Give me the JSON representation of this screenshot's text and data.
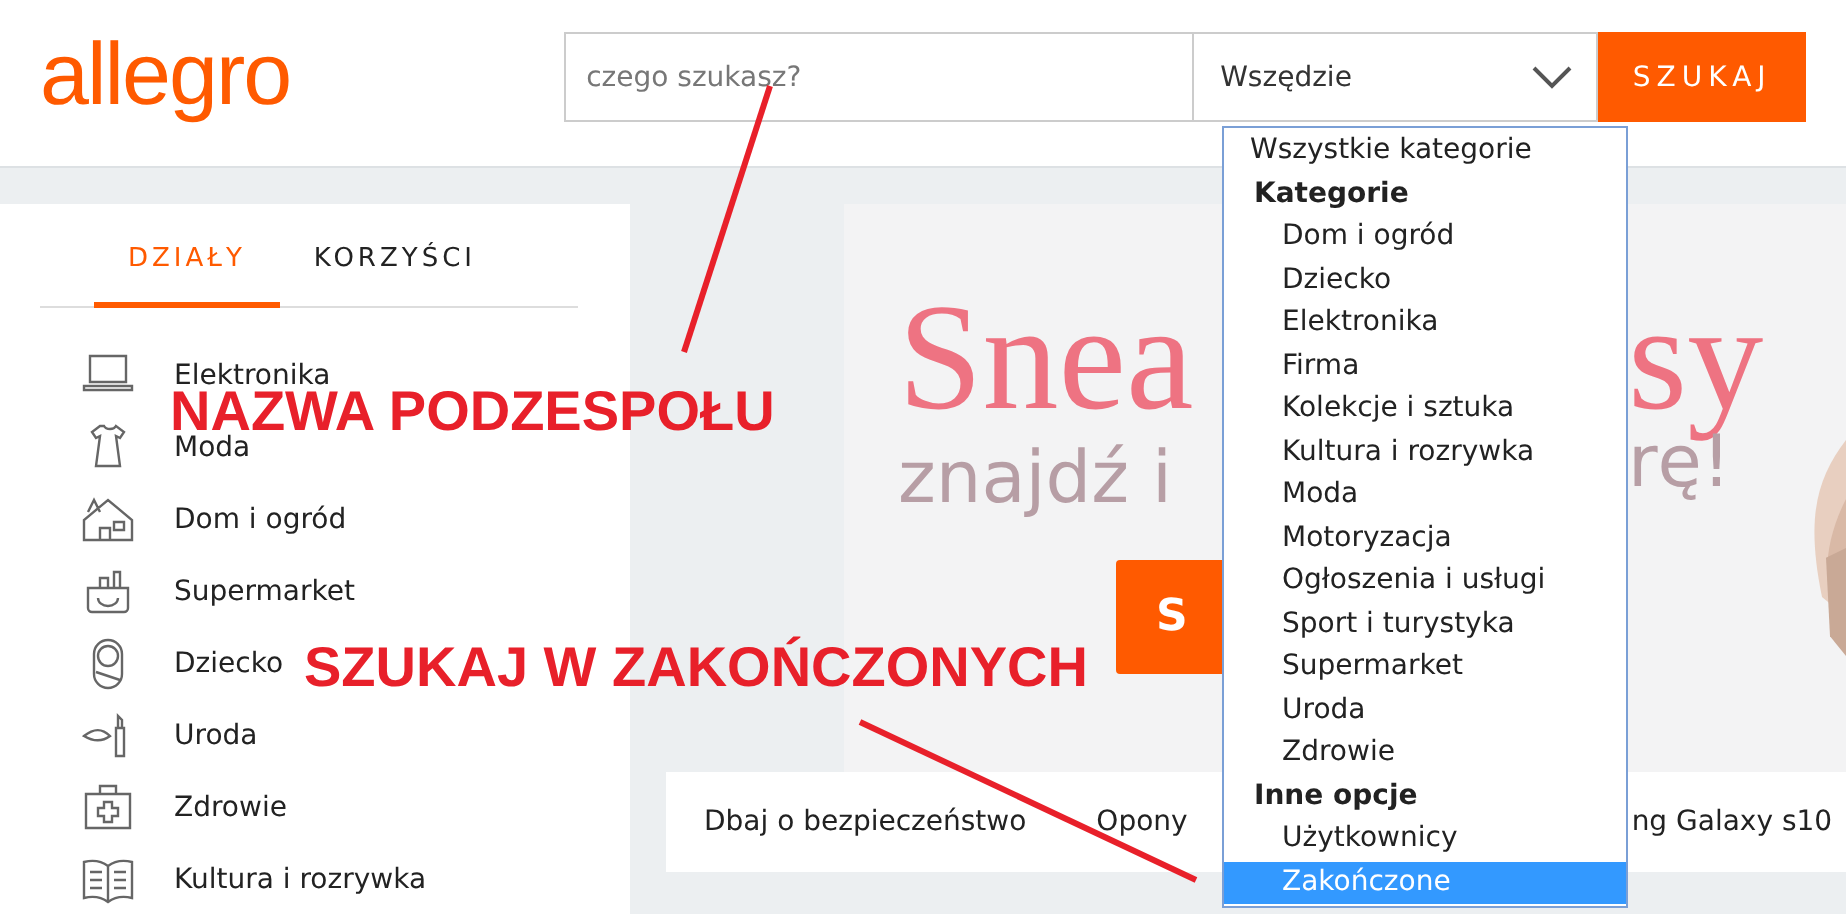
{
  "header": {
    "logo": "allegro",
    "search": {
      "placeholder": "czego szukasz?"
    },
    "scope_select": {
      "value": "Wszędzie"
    },
    "search_button": "SZUKAJ"
  },
  "sidebar": {
    "tabs": [
      {
        "label": "DZIAŁY",
        "selected": true
      },
      {
        "label": "KORZYŚCI",
        "selected": false
      }
    ],
    "items": [
      {
        "label": "Elektronika"
      },
      {
        "label": "Moda"
      },
      {
        "label": "Dom i ogród"
      },
      {
        "label": "Supermarket"
      },
      {
        "label": "Dziecko"
      },
      {
        "label": "Uroda"
      },
      {
        "label": "Zdrowie"
      },
      {
        "label": "Kultura i rozrywka"
      }
    ]
  },
  "banner": {
    "headline": [
      "Snea",
      "sy"
    ],
    "subline": [
      "znajdź i",
      "rę!"
    ],
    "button": "S"
  },
  "quick_links": [
    "Dbaj o bezpieczeństwo",
    "Opony",
    "ng Galaxy s10"
  ],
  "scope_dropdown": {
    "items": [
      {
        "kind": "option",
        "label": "Wszystkie kategorie",
        "selected": false
      },
      {
        "kind": "group",
        "label": "Kategorie"
      },
      {
        "kind": "sub",
        "label": "Dom i ogród",
        "selected": false
      },
      {
        "kind": "sub",
        "label": "Dziecko",
        "selected": false
      },
      {
        "kind": "sub",
        "label": "Elektronika",
        "selected": false
      },
      {
        "kind": "sub",
        "label": "Firma",
        "selected": false
      },
      {
        "kind": "sub",
        "label": "Kolekcje i sztuka",
        "selected": false
      },
      {
        "kind": "sub",
        "label": "Kultura i rozrywka",
        "selected": false
      },
      {
        "kind": "sub",
        "label": "Moda",
        "selected": false
      },
      {
        "kind": "sub",
        "label": "Motoryzacja",
        "selected": false
      },
      {
        "kind": "sub",
        "label": "Ogłoszenia i usługi",
        "selected": false
      },
      {
        "kind": "sub",
        "label": "Sport i turystyka",
        "selected": false
      },
      {
        "kind": "sub",
        "label": "Supermarket",
        "selected": false
      },
      {
        "kind": "sub",
        "label": "Uroda",
        "selected": false
      },
      {
        "kind": "sub",
        "label": "Zdrowie",
        "selected": false
      },
      {
        "kind": "group",
        "label": "Inne opcje"
      },
      {
        "kind": "sub",
        "label": "Użytkownicy",
        "selected": false
      },
      {
        "kind": "sub",
        "label": "Zakończone",
        "selected": true
      }
    ]
  },
  "annotations": [
    {
      "text": "NAZWA PODZESPOŁU"
    },
    {
      "text": "SZUKAJ W ZAKOŃCZONYCH"
    }
  ]
}
